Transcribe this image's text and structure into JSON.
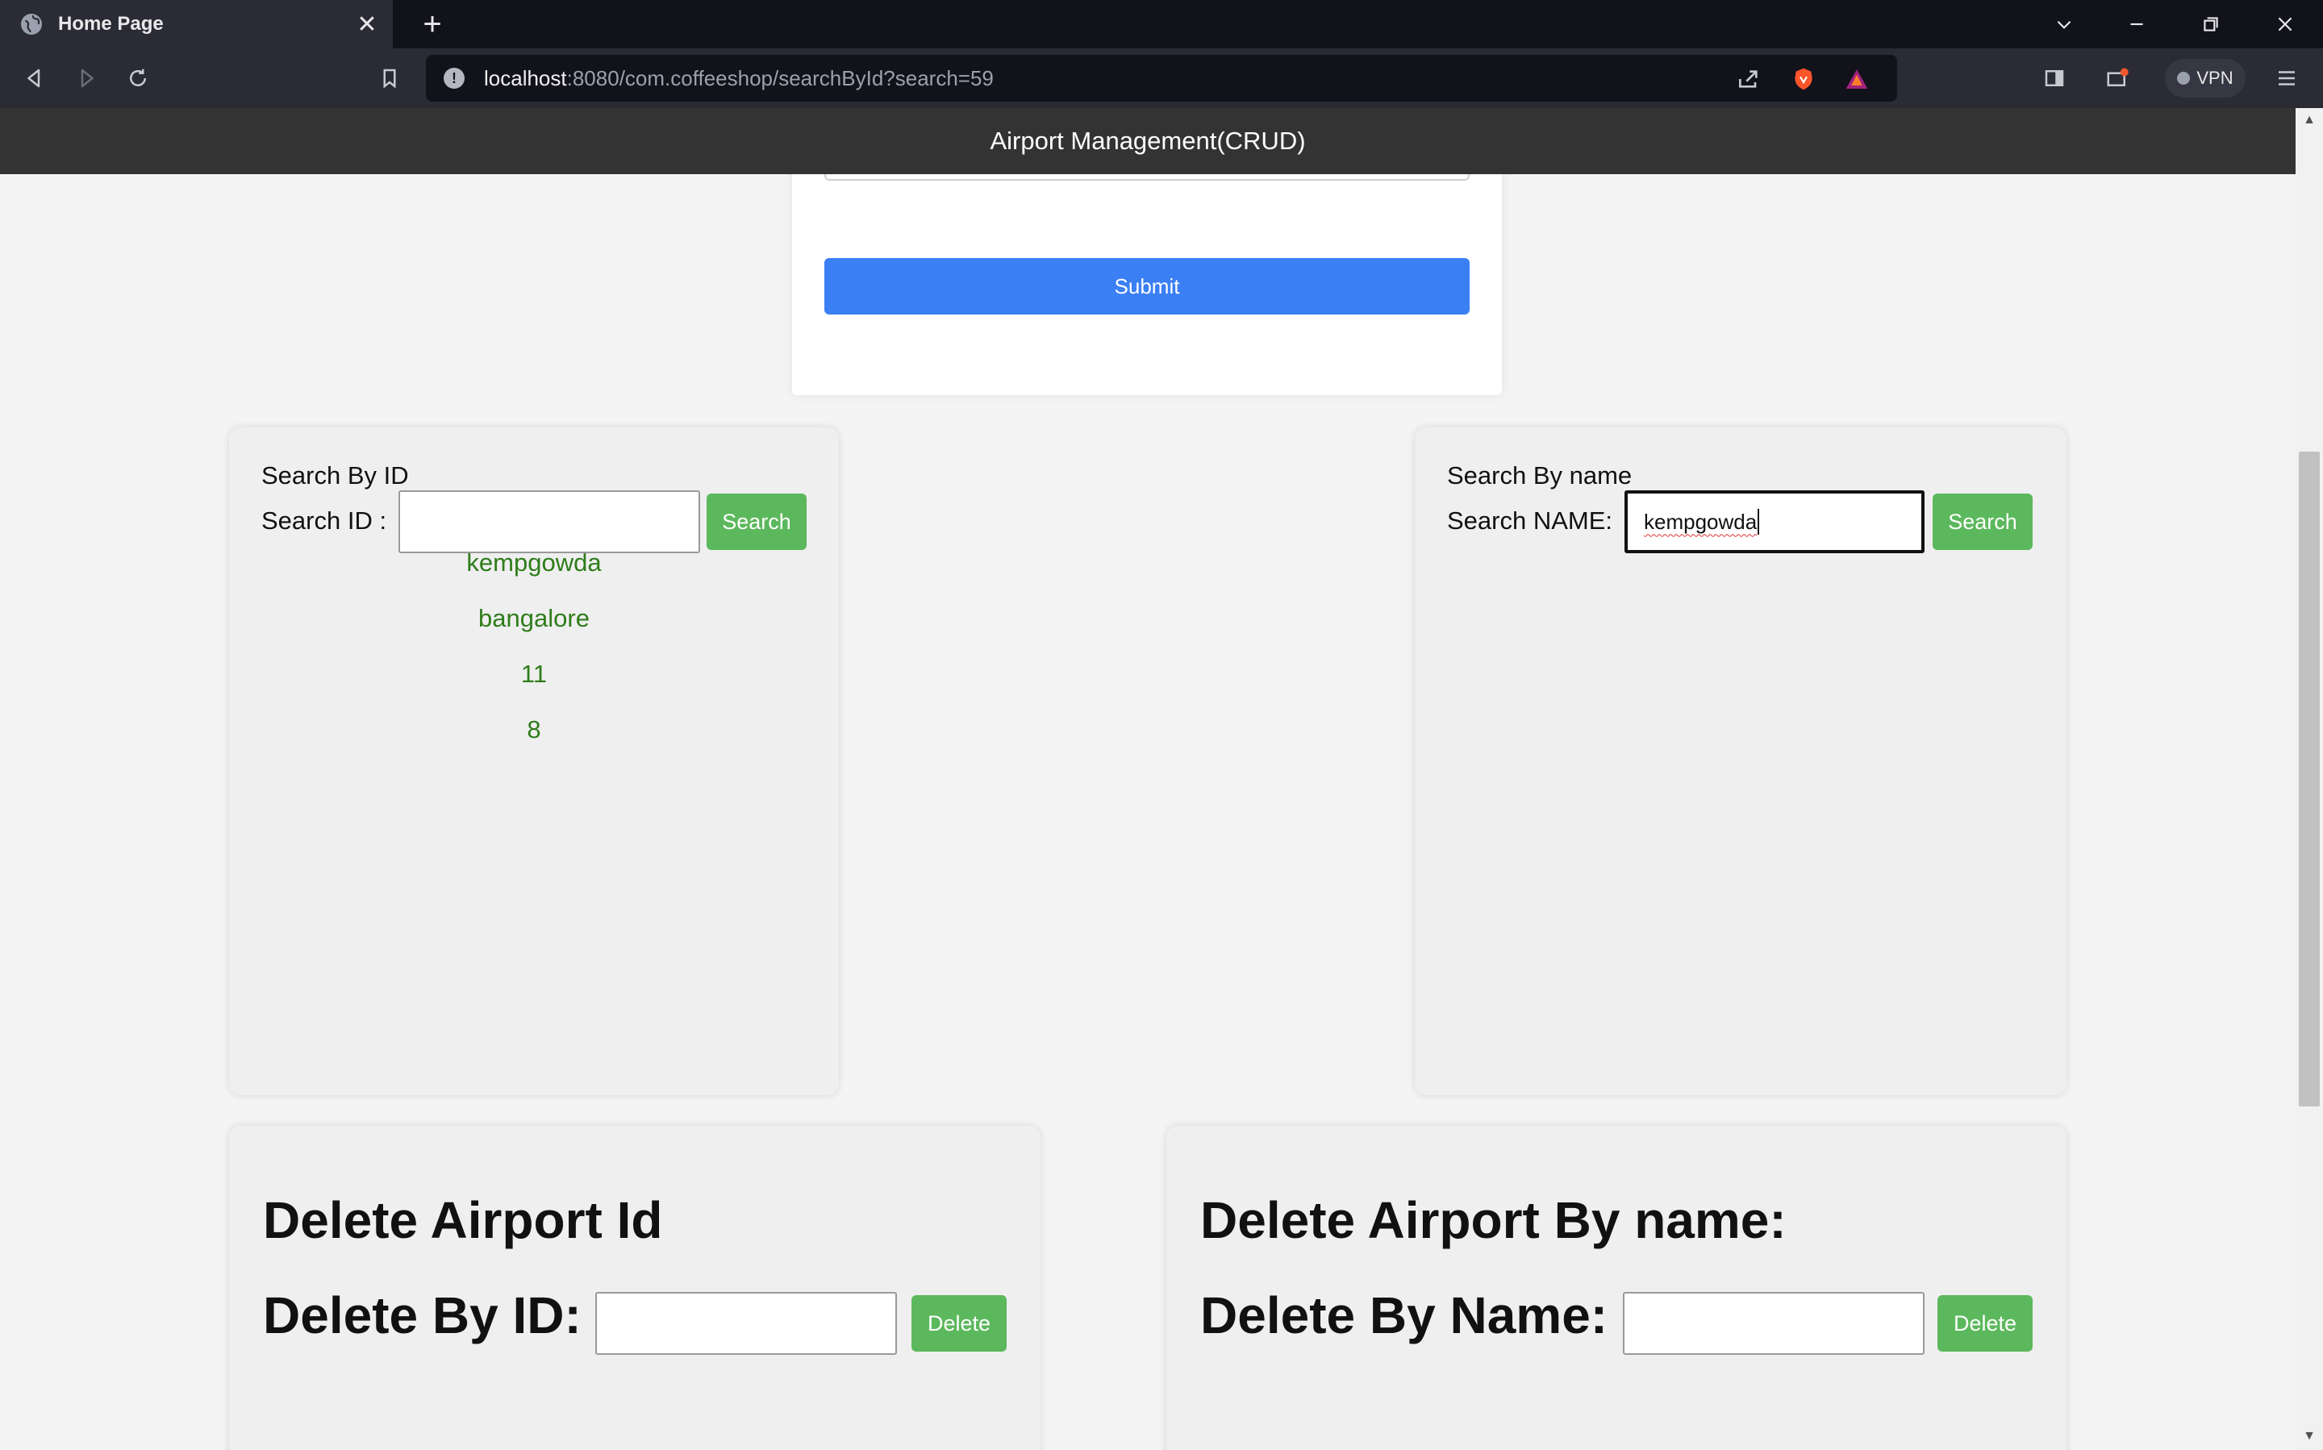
{
  "browser": {
    "tab_title": "Home Page",
    "url_host": "localhost",
    "url_rest": ":8080/com.coffeeshop/searchById?search=59",
    "vpn_label": "VPN"
  },
  "page": {
    "header_title": "Airport Management(CRUD)",
    "submit_label": "Submit",
    "search_by_id": {
      "heading": "Search By ID",
      "field_label": "Search ID :",
      "input_value": "",
      "button_label": "Search",
      "results": [
        "kempgowda",
        "bangalore",
        "11",
        "8"
      ]
    },
    "search_by_name": {
      "heading": "Search By name",
      "field_label": "Search NAME:",
      "input_value": "kempgowda",
      "button_label": "Search"
    },
    "delete_by_id": {
      "heading": "Delete Airport Id",
      "field_label": "Delete By ID:",
      "input_value": "",
      "button_label": "Delete"
    },
    "delete_by_name": {
      "heading": "Delete Airport By name:",
      "field_label": "Delete By Name:",
      "input_value": "",
      "button_label": "Delete"
    }
  },
  "colors": {
    "accent_blue": "#3b7ff5",
    "button_green": "#5cb85c",
    "result_green": "#2e7d1a",
    "header_bg": "#333333"
  }
}
